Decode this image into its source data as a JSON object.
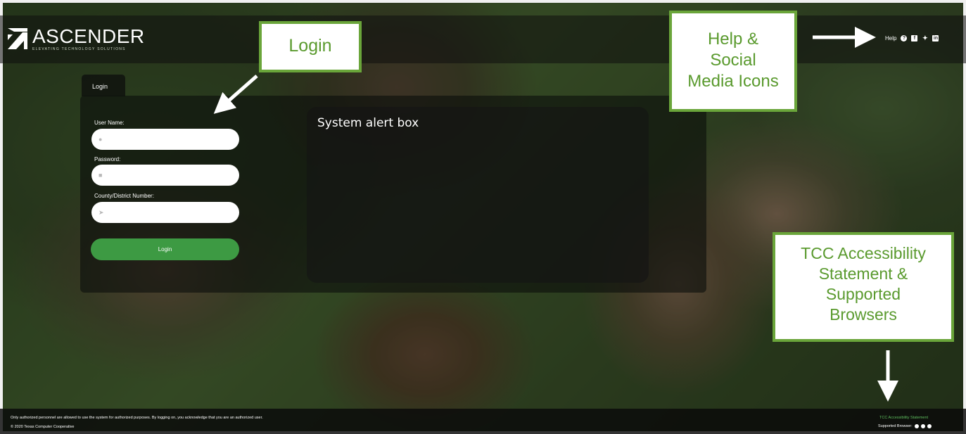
{
  "brand": {
    "name": "ASCENDER",
    "tagline": "ELEVATING TECHNOLOGY SOLUTIONS"
  },
  "header": {
    "help_label": "Help",
    "icons": [
      "help-icon",
      "facebook-icon",
      "twitter-icon",
      "linkedin-icon"
    ]
  },
  "login": {
    "tab_label": "Login",
    "username_label": "User Name:",
    "password_label": "Password:",
    "district_label": "County/District Number:",
    "button_label": "Login"
  },
  "alert": {
    "text": "System alert box"
  },
  "footer": {
    "notice": "Only authorized personnel are allowed to use the system for authorized purposes. By logging on, you acknowledge that you are an authorized user.",
    "copyright": "© 2020 Texas Computer Cooperative",
    "accessibility_link": "TCC Accessibility Statement",
    "browsers_label": "Supported Browser:"
  },
  "callouts": {
    "login": "Login",
    "help_line1": "Help &",
    "help_line2": "Social",
    "help_line3": "Media Icons",
    "tcc_line1": "TCC Accessibility",
    "tcc_line2": "Statement &",
    "tcc_line3": "Supported",
    "tcc_line4": "Browsers"
  },
  "colors": {
    "accent_green": "#3d9a43",
    "callout_border": "#6aa53a",
    "link_green": "#5fbf5f"
  }
}
